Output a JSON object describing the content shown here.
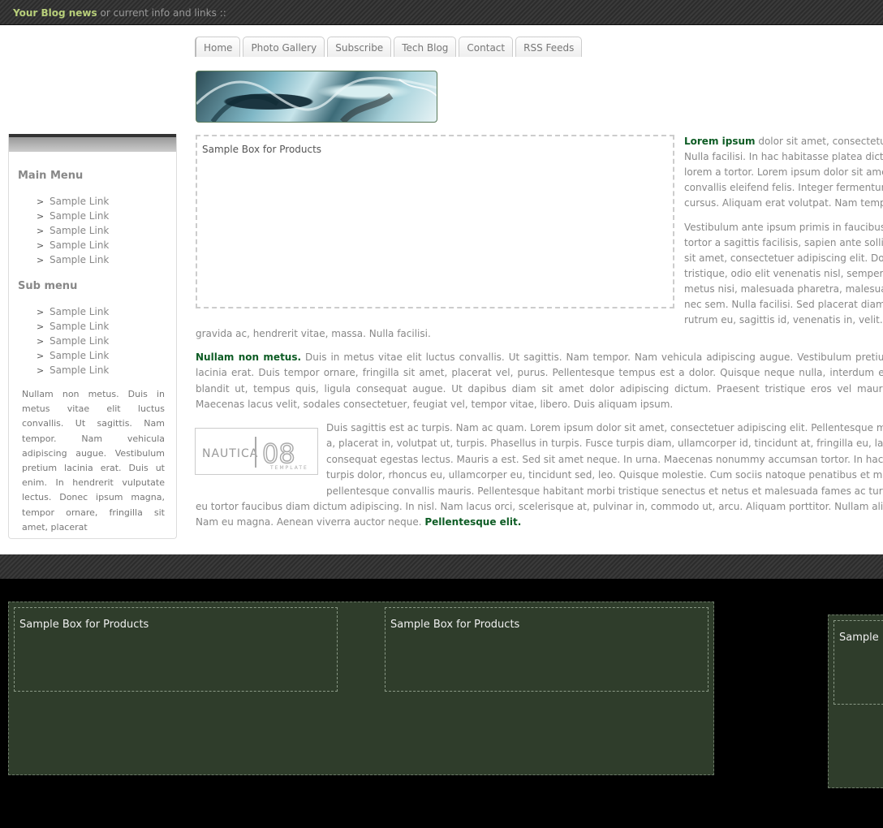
{
  "topbar": {
    "highlight": "Your Blog news",
    "rest": " or current info and links ::"
  },
  "nav": {
    "tabs": [
      "Home",
      "Photo Gallery",
      "Subscribe",
      "Tech Blog",
      "Contact",
      "RSS Feeds"
    ]
  },
  "sidebar": {
    "main_menu_title": "Main Menu",
    "main_menu": [
      "Sample Link",
      "Sample Link",
      "Sample Link",
      "Sample Link",
      "Sample Link"
    ],
    "sub_menu_title": "Sub menu",
    "sub_menu": [
      "Sample Link",
      "Sample Link",
      "Sample Link",
      "Sample Link",
      "Sample Link"
    ],
    "text": "Nullam non metus. Duis in metus vitae elit luctus convallis. Ut sagittis. Nam tempor. Nam vehicula adipiscing augue. Vestibulum pretium lacinia erat. Duis ut enim. In hendrerit vulputate lectus. Donec ipsum magna, tempor ornare, fringilla sit amet, placerat"
  },
  "main": {
    "product_box_title": "Sample Box for Products",
    "right_col": {
      "lead": "Lorem ipsum",
      "p1_rest": " dolor sit amet, consectetuer",
      "p1_lines": [
        "Nulla facilisi. In hac habitasse platea dictum",
        "lorem a tortor. Lorem ipsum dolor sit amet,",
        "convallis eleifend felis. Integer fermentum",
        "cursus. Aliquam erat volutpat. Nam tempus."
      ],
      "p2_lines": [
        "Vestibulum ante ipsum primis in faucibus or",
        "tortor a sagittis facilisis, sapien ante sollicitu",
        "sit amet, consectetuer adipiscing elit. Do",
        "tristique, odio elit venenatis nisl, semper c",
        "metus nisi, malesuada pharetra, malesuada",
        "nec sem. Nulla facilisi. Sed placerat diam ut",
        "rutrum eu, sagittis id, venenatis in, velit."
      ]
    },
    "gravida_line": "gravida ac, hendrerit vitae, massa. Nulla facilisi.",
    "p3_lead": "Nullam non metus.",
    "p3_rest": " Duis in metus vitae elit luctus convallis. Ut sagittis. Nam tempor. Nam vehicula adipiscing augue. Vestibulum pretium lacinia erat. Duis tempor ornare, fringilla sit amet, placerat vel, purus. Pellentesque tempus est a dolor. Quisque neque nulla, interdum eu, blandit ut, tempus quis, ligula consequat augue. Ut dapibus diam sit amet dolor adipiscing dictum. Praesent tristique eros vel mauris. Maecenas lacus velit, sodales consectetuer, feugiat vel, tempor vitae, libero. Duis aliquam ipsum.",
    "logo_word": "NAUTICA",
    "logo_num": "08",
    "logo_sub": "TEMPLATE",
    "p4_lines": [
      "Duis sagittis est ac turpis. Nam ac quam. Lorem ipsum dolor sit amet, consectetuer adipiscing elit. Pellentesque malesuada",
      "a, placerat in, volutpat ut, turpis. Phasellus in turpis. Fusce turpis diam, ullamcorper id, tincidunt at, fringilla eu, lac",
      "consequat egestas lectus. Mauris a est. Sed sit amet neque. In urna. Maecenas nonummy accumsan tortor. In hac habi",
      "turpis dolor, rhoncus eu, ullamcorper eu, tincidunt sed, leo. Quisque molestie. Cum sociis natoque penatibus et ma",
      "pellentesque convallis mauris. Pellentesque habitant morbi tristique senectus et netus et malesuada fames ac turpis egest"
    ],
    "p4_tail": [
      "eu tortor faucibus diam dictum adipiscing. In nisl. Nam lacus orci, scelerisque at, pulvinar in, commodo ut, arcu. Aliquam porttitor. Nullam aliquet risus i",
      "Nam eu magna. Aenean viverra auctor neque. "
    ],
    "p4_end": "Pellentesque elit."
  },
  "footer": {
    "box1_title": "Sample Box for Products",
    "box2_title": "Sample Box for Products",
    "box3_title": "Sample B"
  }
}
